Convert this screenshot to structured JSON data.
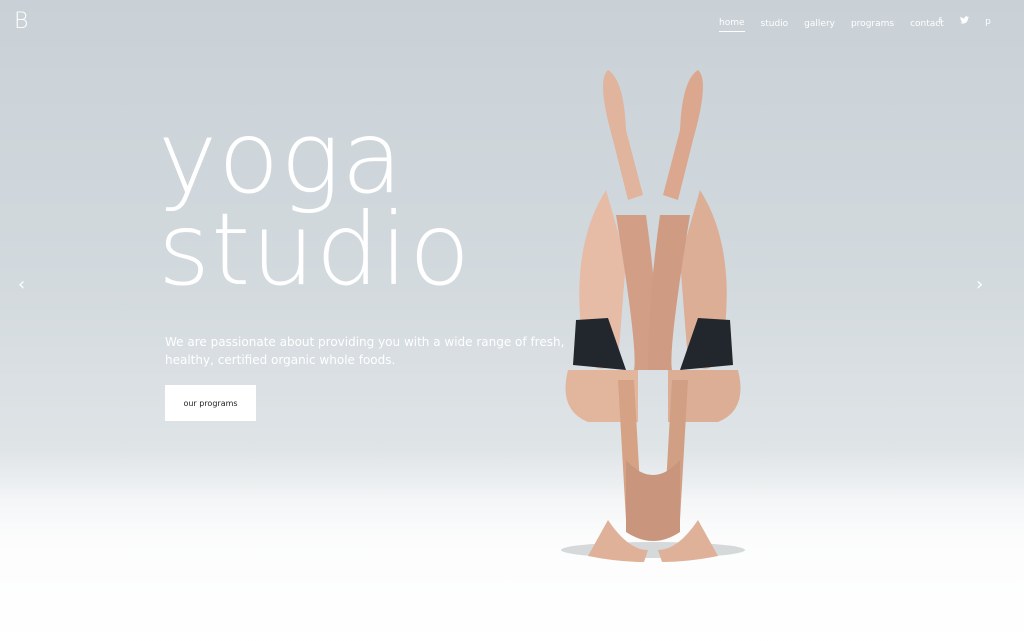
{
  "logo": {
    "letter": "B"
  },
  "nav": {
    "items": [
      {
        "label": "home",
        "active": true
      },
      {
        "label": "studio"
      },
      {
        "label": "gallery"
      },
      {
        "label": "programs"
      },
      {
        "label": "contact"
      }
    ]
  },
  "social": {
    "facebook": "f",
    "twitter": "t",
    "pinterest": "p"
  },
  "hero": {
    "title_line1": "yoga",
    "title_line2": "studio",
    "tagline": "We are passionate about providing you with a wide range of fresh, healthy, certified organic whole foods.",
    "cta": "our programs"
  },
  "slider": {
    "prev": "‹",
    "next": "›"
  },
  "colors": {
    "accent": "#ffffff",
    "background": "#d3dade"
  }
}
